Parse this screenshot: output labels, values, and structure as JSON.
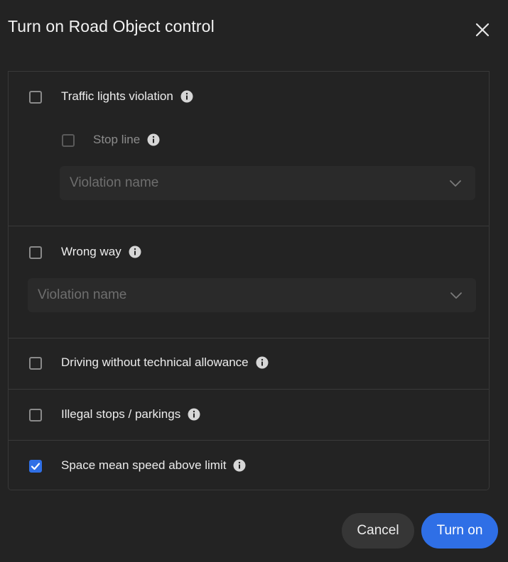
{
  "dialog": {
    "title": "Turn on Road Object control",
    "close_icon": "close-icon"
  },
  "options": [
    {
      "id": "traffic-lights-violation",
      "label": "Traffic lights violation",
      "checked": false,
      "sub_option": {
        "label": "Stop line",
        "checked": false,
        "enabled": false
      },
      "select_placeholder": "Violation name",
      "select_enabled": false
    },
    {
      "id": "wrong-way",
      "label": "Wrong way",
      "checked": false,
      "select_placeholder": "Violation name",
      "select_enabled": false
    },
    {
      "id": "driving-without-technical-allowance",
      "label": "Driving without technical allowance",
      "checked": false
    },
    {
      "id": "illegal-stops-parkings",
      "label": "Illegal stops / parkings",
      "checked": false
    },
    {
      "id": "space-mean-speed-above-limit",
      "label": "Space mean speed above limit",
      "checked": true
    }
  ],
  "footer": {
    "cancel_label": "Cancel",
    "confirm_label": "Turn on"
  },
  "colors": {
    "background": "#232323",
    "accent": "#2f6fe6",
    "border": "#3a3a3a",
    "text": "#ececec",
    "placeholder": "#6e6e6e"
  }
}
